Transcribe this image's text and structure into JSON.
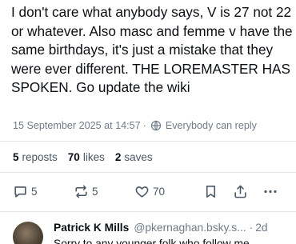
{
  "post": {
    "text": "I don't care what anybody says, V is 27 not 22 or whatever. Also masc and femme v have the same birthdays, it's just a mistake that they were ever different. THE LOREMASTER HAS SPOKEN. Go update the wiki",
    "date": "15 September 2025 at 14:57",
    "separator": "·",
    "reply_setting": "Everybody can reply"
  },
  "stats": {
    "reposts_count": "5",
    "reposts_label": "reposts",
    "likes_count": "70",
    "likes_label": "likes",
    "saves_count": "2",
    "saves_label": "saves"
  },
  "actions": {
    "reply_count": "5",
    "repost_count": "5",
    "like_count": "70",
    "icons": [
      "reply-icon",
      "repost-icon",
      "like-icon",
      "bookmark-icon",
      "share-icon",
      "more-icon"
    ]
  },
  "reply": {
    "author_name": "Patrick K Mills",
    "handle": "@pkernaghan.bsky.s...",
    "separator": "·",
    "time": "2d",
    "text": "Sorry to any younger folk who follow me"
  },
  "colors": {
    "text": "#0b0f14",
    "muted": "#6f7b88",
    "divider": "#e4e8ec",
    "background": "#ffffff"
  }
}
